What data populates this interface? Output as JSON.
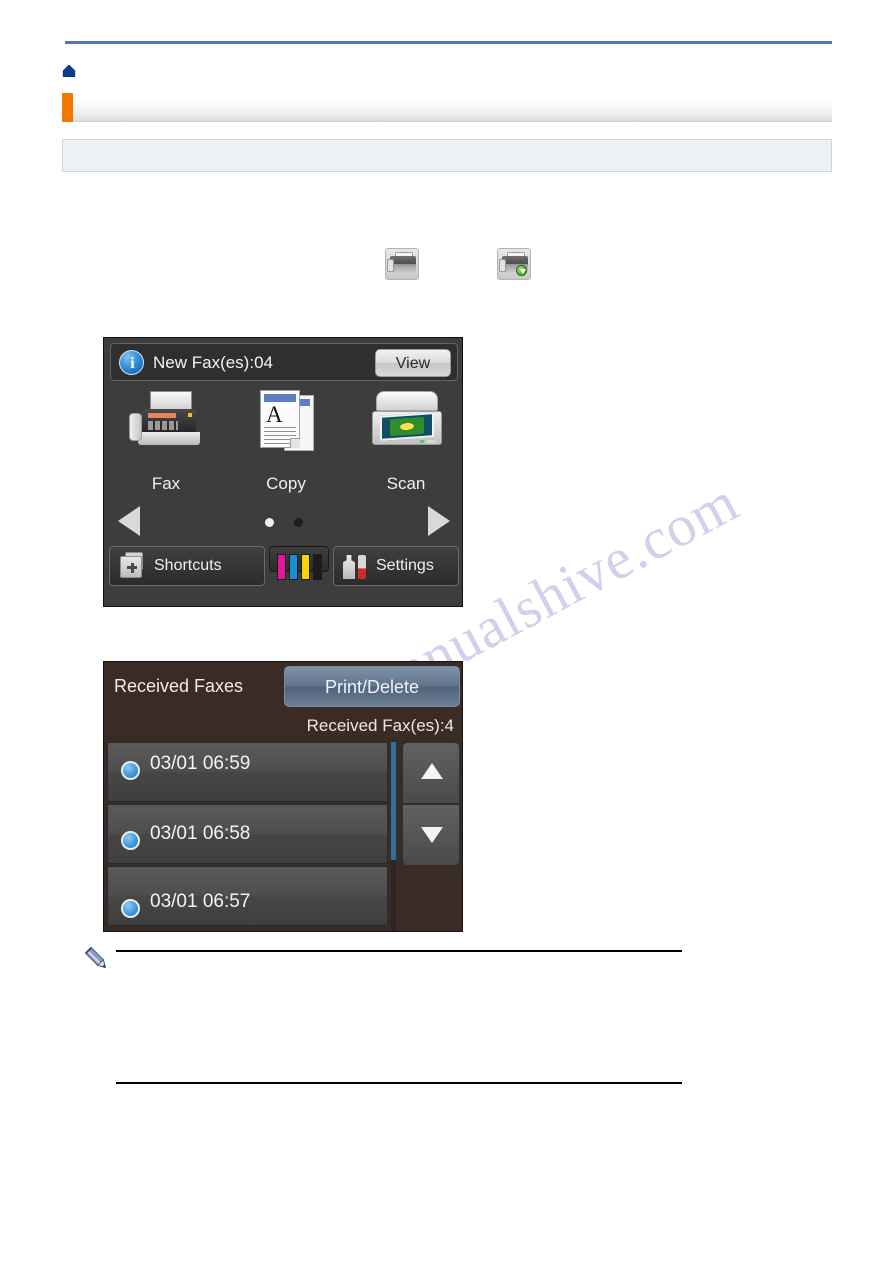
{
  "page": {
    "breadcrumb": "",
    "title": "",
    "info_note": "",
    "intro": "",
    "note_text": "",
    "watermark": "manualshive.com"
  },
  "colors": {
    "top_rule": "#5a6ec8",
    "title_accent": "#f07800",
    "info_box_fill": "#eef1f4",
    "home_icon": "#0b3a8f",
    "lcd1_bg": "#3d3d3d",
    "lcd2_bg": "#3b2b25",
    "accent_button": "#61748c",
    "bullet_blue": "#2f8ed6",
    "scrollbar": "#2f6f9e"
  },
  "inline_icons": [
    {
      "name": "fax-icon",
      "label": "Fax"
    },
    {
      "name": "fax-receive-icon",
      "label": "Fax Receive"
    }
  ],
  "lcd_home": {
    "status": {
      "icon": "info-icon",
      "glyph": "i",
      "text": "New Fax(es):04",
      "view_label": "View"
    },
    "apps": [
      {
        "key": "fax",
        "label": "Fax"
      },
      {
        "key": "copy",
        "label": "Copy"
      },
      {
        "key": "scan",
        "label": "Scan"
      }
    ],
    "nav": {
      "left_icon": "arrow-left-icon",
      "right_icon": "arrow-right-icon",
      "pages": 2,
      "active_page": 1
    },
    "bottom_bar": {
      "shortcuts_label": "Shortcuts",
      "settings_label": "Settings",
      "ink_colors": [
        "#e0179a",
        "#1b8ed4",
        "#f5d30a",
        "#1b1b1b"
      ]
    }
  },
  "lcd_received": {
    "title": "Received Faxes",
    "print_delete_label": "Print/Delete",
    "count_label": "Received Fax(es):4",
    "rows": [
      {
        "date": "03/01 06:59"
      },
      {
        "date": "03/01 06:58"
      },
      {
        "date": "03/01 06:57"
      }
    ],
    "scroll_up_icon": "triangle-up-icon",
    "scroll_down_icon": "triangle-down-icon"
  }
}
